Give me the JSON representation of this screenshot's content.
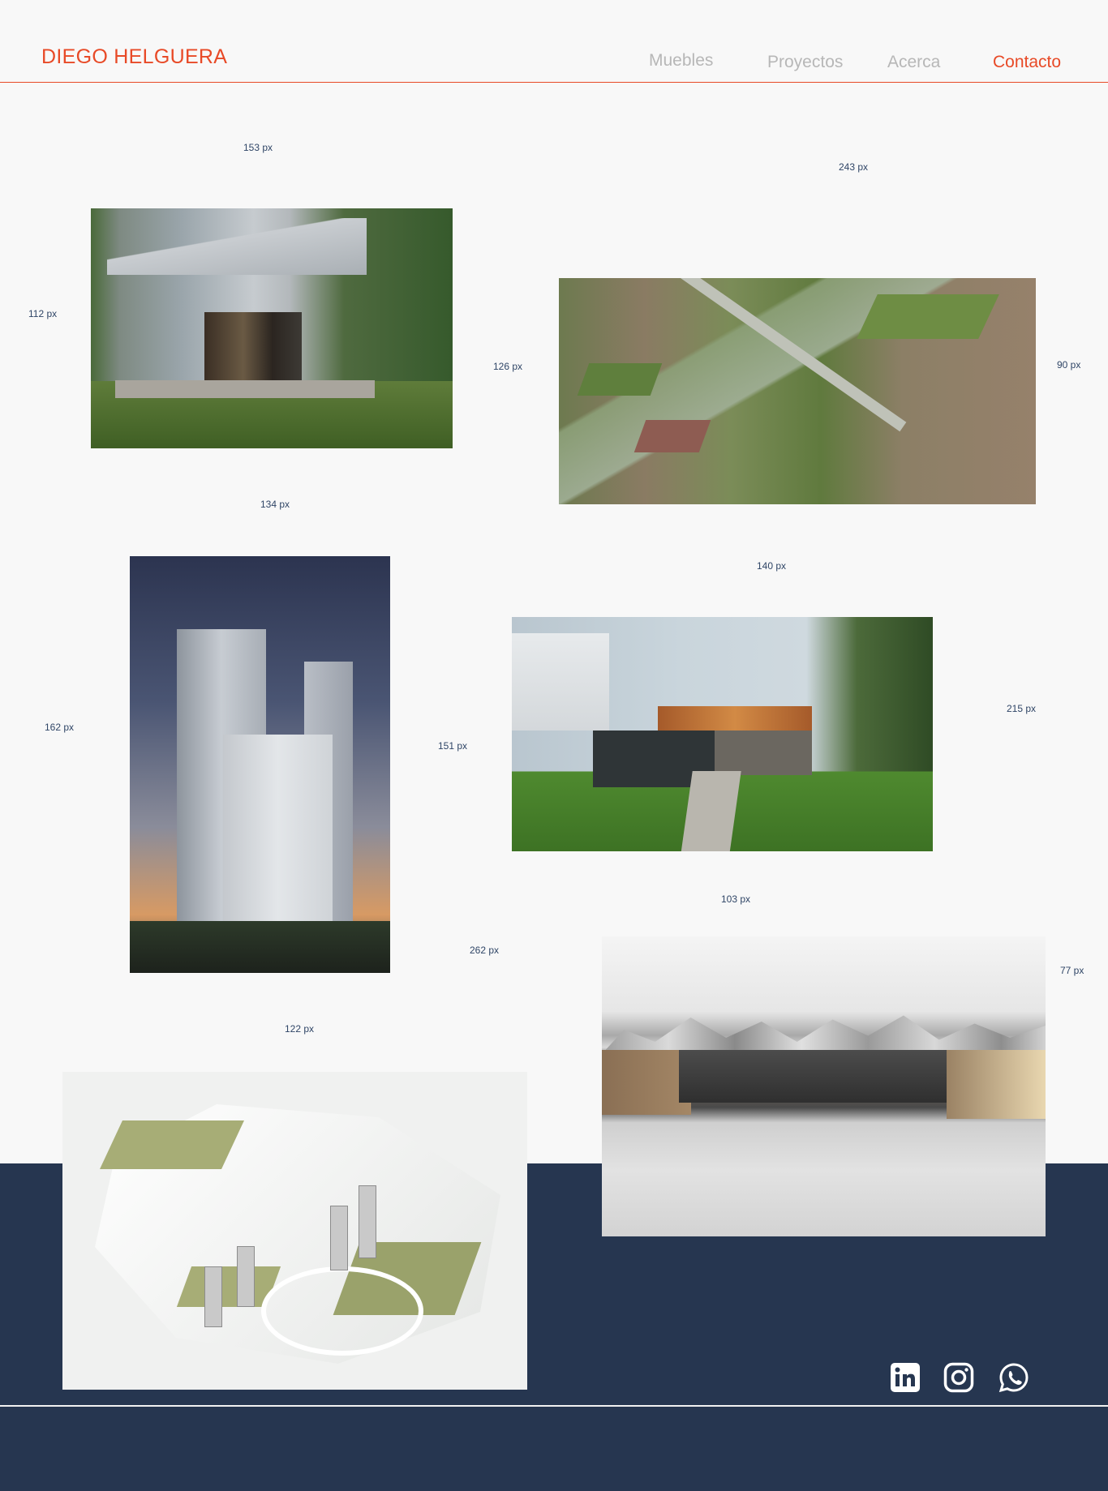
{
  "header": {
    "brand": "DIEGO HELGUERA",
    "nav": [
      {
        "label": "Muebles",
        "active": false
      },
      {
        "label": "Proyectos",
        "active": false
      },
      {
        "label": "Acerca",
        "active": false
      },
      {
        "label": "Contacto",
        "active": true
      }
    ],
    "accent_color": "#e84a27",
    "nav_color": "#b7b7b7"
  },
  "measures": [
    "153 px",
    "243 px",
    "112 px",
    "126 px",
    "90 px",
    "134 px",
    "140 px",
    "162 px",
    "151 px",
    "215 px",
    "103 px",
    "262 px",
    "77 px",
    "122 px"
  ],
  "projects": [
    {
      "subject": "corrugated metal cabin"
    },
    {
      "subject": "aerial site rendering"
    },
    {
      "subject": "high-rise tower at dusk"
    },
    {
      "subject": "house with lawn and garden path"
    },
    {
      "subject": "museum with mountain backdrop"
    },
    {
      "subject": "axonometric masterplan"
    }
  ],
  "footer": {
    "background_color": "#263650",
    "social": [
      {
        "icon": "linkedin-icon"
      },
      {
        "icon": "instagram-icon"
      },
      {
        "icon": "whatsapp-icon"
      }
    ]
  }
}
